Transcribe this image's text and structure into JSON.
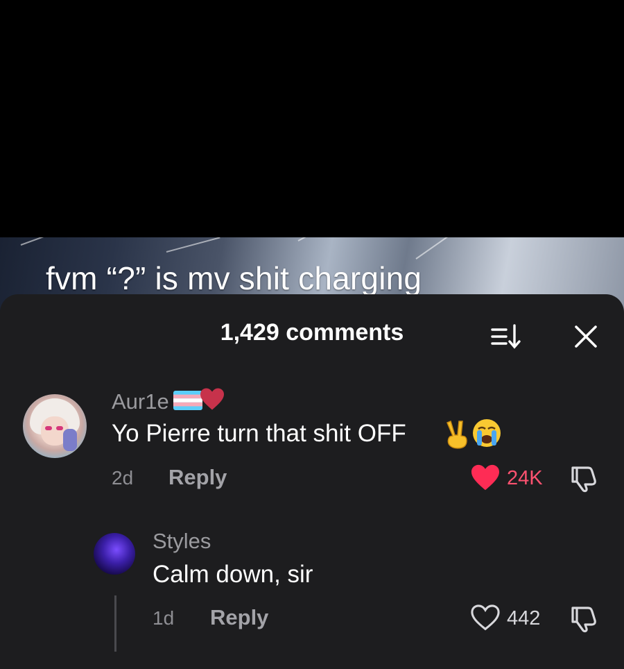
{
  "video": {
    "caption": "fvm “?” is mv shit charging"
  },
  "comments_panel": {
    "title": "1,429 comments"
  },
  "comments": [
    {
      "username": "Aur1e",
      "username_emojis": [
        "transgender-flag",
        "red-heart"
      ],
      "text": "Yo Pierre turn that shit OFF",
      "text_emojis": [
        "victory-hand",
        "loudly-crying-face"
      ],
      "time": "2d",
      "reply_label": "Reply",
      "likes": "24K",
      "liked": true
    },
    {
      "username": "Styles",
      "text": "Calm down, sir",
      "time": "1d",
      "reply_label": "Reply",
      "likes": "442",
      "liked": false
    }
  ],
  "colors": {
    "sheet_bg": "#1d1d1f",
    "like_active": "#fe2c55",
    "text_secondary": "#9b9b9f"
  }
}
